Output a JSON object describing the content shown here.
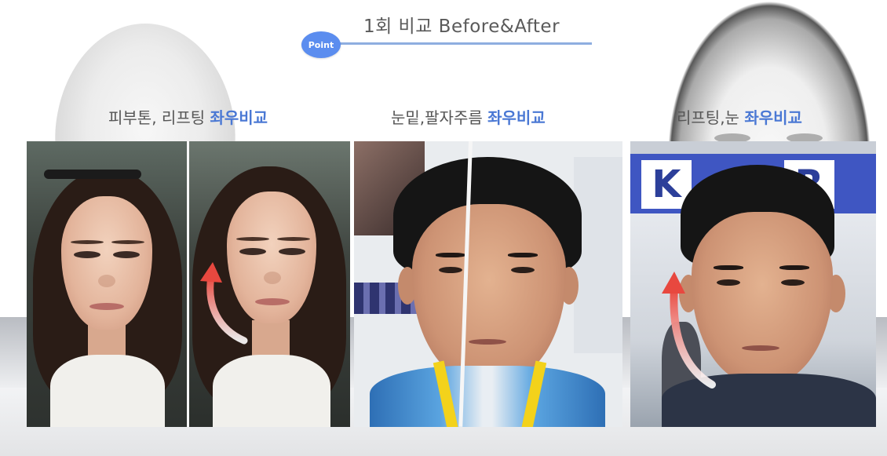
{
  "header": {
    "title": "1회 비교 Before&After",
    "badge_label": "Point",
    "accent_color": "#5b8def"
  },
  "comparisons": [
    {
      "caption_prefix": "피부톤, 리프팅 ",
      "caption_highlight": "좌우비교"
    },
    {
      "caption_prefix": "눈밑,팔자주름 ",
      "caption_highlight": "좌우비교"
    },
    {
      "caption_prefix": "리프팅,눈 ",
      "caption_highlight": "좌우비교"
    }
  ],
  "sign_letters": [
    "K",
    "R"
  ],
  "colors": {
    "highlight": "#4a78d4",
    "arrow": "#e8483f"
  }
}
